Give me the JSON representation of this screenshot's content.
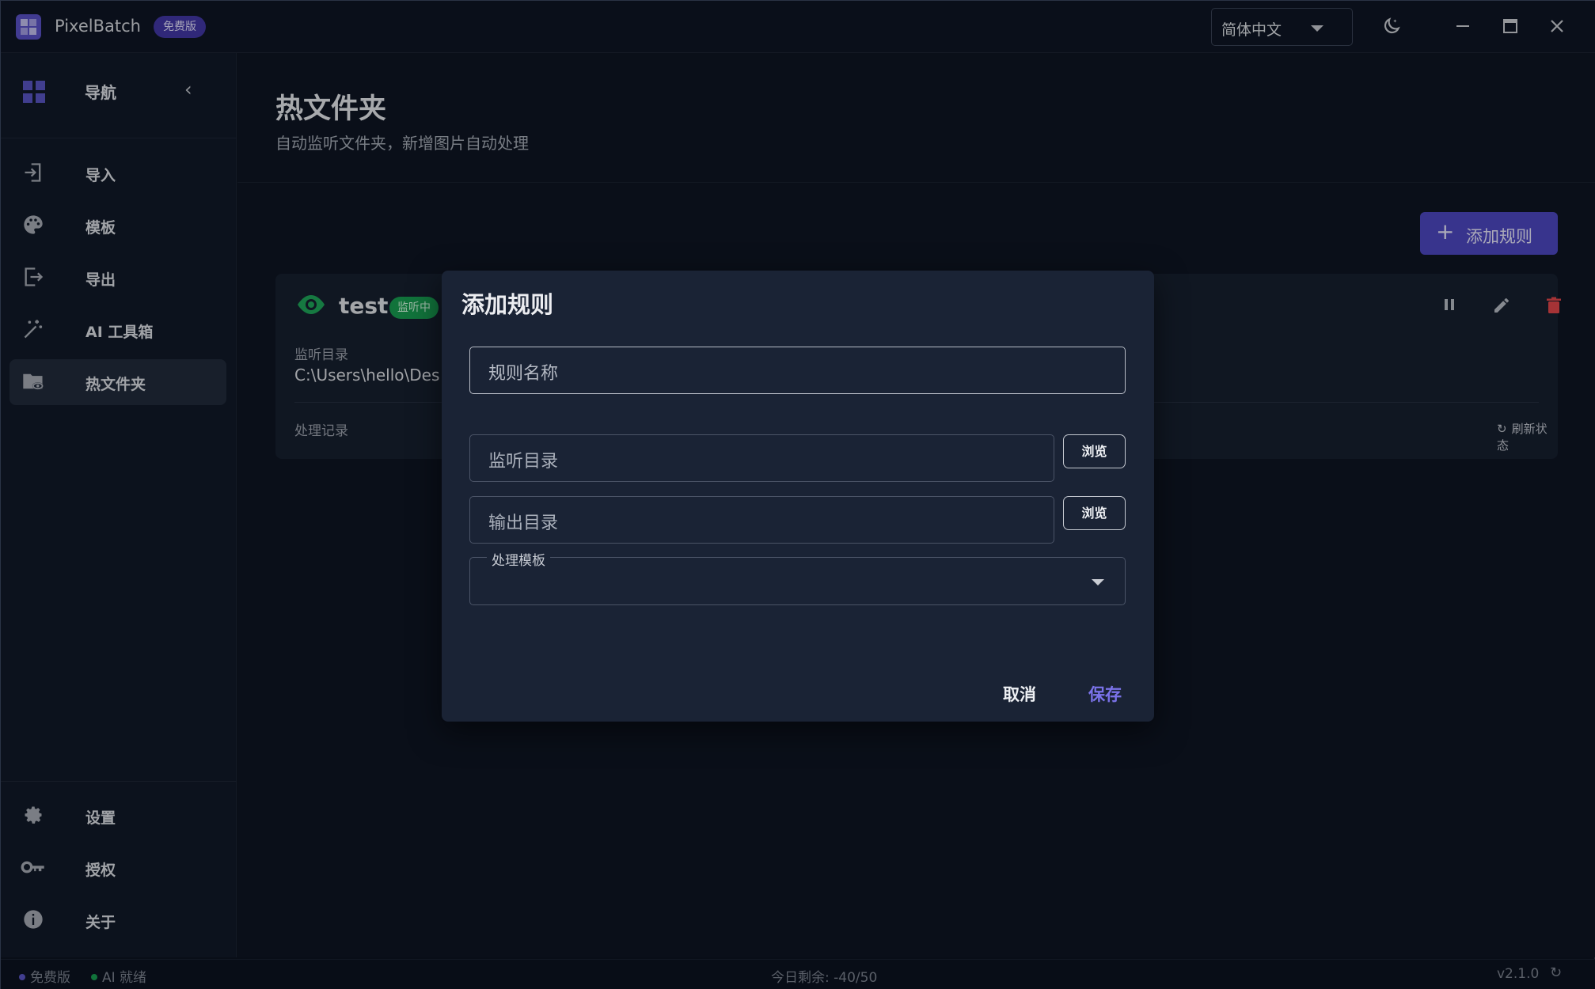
{
  "app": {
    "name": "PixelBatch",
    "plan_badge": "免费版",
    "language": "简体中文",
    "accent": "#4e48c4"
  },
  "window_controls": [
    "theme-toggle-icon",
    "minimize-icon",
    "maximize-icon",
    "close-icon"
  ],
  "sidebar": {
    "title": "导航",
    "items": [
      {
        "label": "导入",
        "icon": "import-icon"
      },
      {
        "label": "模板",
        "icon": "palette-icon"
      },
      {
        "label": "导出",
        "icon": "export-icon"
      },
      {
        "label": "AI 工具箱",
        "icon": "magic-wand-icon"
      },
      {
        "label": "热文件夹",
        "icon": "folder-eye-icon",
        "active": true
      }
    ],
    "bottom_items": [
      {
        "label": "设置",
        "icon": "gear-icon"
      },
      {
        "label": "授权",
        "icon": "key-icon"
      },
      {
        "label": "关于",
        "icon": "info-icon"
      }
    ]
  },
  "page": {
    "title": "热文件夹",
    "subtitle": "自动监听文件夹，新增图片自动处理",
    "add_rule_label": "添加规则"
  },
  "rule_card": {
    "name": "test",
    "status": "监听中",
    "status_color": "#18a052",
    "watch_dir_label": "监听目录",
    "watch_dir_value": "C:\\Users\\hello\\Des",
    "history_label": "处理记录",
    "refresh_label": "刷新状态"
  },
  "dialog": {
    "title": "添加规则",
    "rule_name_placeholder": "规则名称",
    "watch_dir_placeholder": "监听目录",
    "output_dir_placeholder": "输出目录",
    "browse_label": "浏览",
    "template_label": "处理模板",
    "template_value": "",
    "cancel_label": "取消",
    "save_label": "保存"
  },
  "statusbar": {
    "plan": "免费版",
    "plan_dot_color": "#5b56c7",
    "ai_status": "AI 就绪",
    "ai_dot_color": "#18a052",
    "quota": "今日剩余: -40/50",
    "version": "v2.1.0"
  }
}
